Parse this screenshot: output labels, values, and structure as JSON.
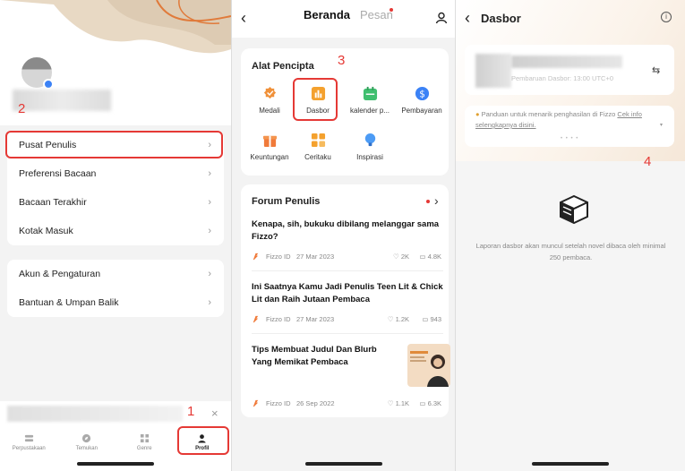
{
  "panel1": {
    "menu_group1": [
      "Pusat Penulis",
      "Preferensi Bacaan",
      "Bacaan Terakhir",
      "Kotak Masuk"
    ],
    "menu_group2": [
      "Akun & Pengaturan",
      "Bantuan & Umpan Balik"
    ],
    "chevron": "›",
    "close_glyph": "×",
    "tabs": [
      "Perpustakaan",
      "Temukan",
      "Genre",
      "Profil"
    ],
    "annotations": {
      "one": "1",
      "two": "2"
    }
  },
  "panel2": {
    "back_glyph": "‹",
    "tab_home": "Beranda",
    "tab_messages": "Pesan",
    "tools_title": "Alat Pencipta",
    "tools": [
      "Medali",
      "Dasbor",
      "kalender p...",
      "Pembayaran",
      "Keuntungan",
      "Ceritaku",
      "Inspirasi"
    ],
    "annotation_three": "3",
    "forum_title": "Forum Penulis",
    "forum_arrow": "›",
    "posts": [
      {
        "title": "Kenapa, sih, bukuku dibilang melanggar sama Fizzo?",
        "source": "Fizzo ID",
        "date": "27 Mar 2023",
        "likes": "2K",
        "comments": "4.8K"
      },
      {
        "title": "Ini Saatnya Kamu Jadi Penulis Teen Lit & Chick Lit dan Raih Jutaan Pembaca",
        "source": "Fizzo ID",
        "date": "27 Mar 2023",
        "likes": "1.2K",
        "comments": "943"
      },
      {
        "title": "Tips Membuat Judul Dan Blurb Yang Memikat Pembaca",
        "source": "Fizzo ID",
        "date": "26 Sep 2022",
        "likes": "1.1K",
        "comments": "6.3K"
      }
    ],
    "accent": "#e53935"
  },
  "panel3": {
    "back_glyph": "‹",
    "title": "Dasbor",
    "info_glyph": "i",
    "update_text": "Pembaruan Dasbor: 13:00 UTC+0",
    "swap_glyph": "⇆",
    "notice_text": "Panduan untuk menarik penghasilan di Fizzo",
    "notice_link": "Cek info selengkapnya disini.",
    "notice_dots": "• • • •",
    "annotation_four": "4",
    "empty_text": "Laporan dasbor akan muncul setelah novel dibaca oleh minimal 250 pembaca."
  }
}
